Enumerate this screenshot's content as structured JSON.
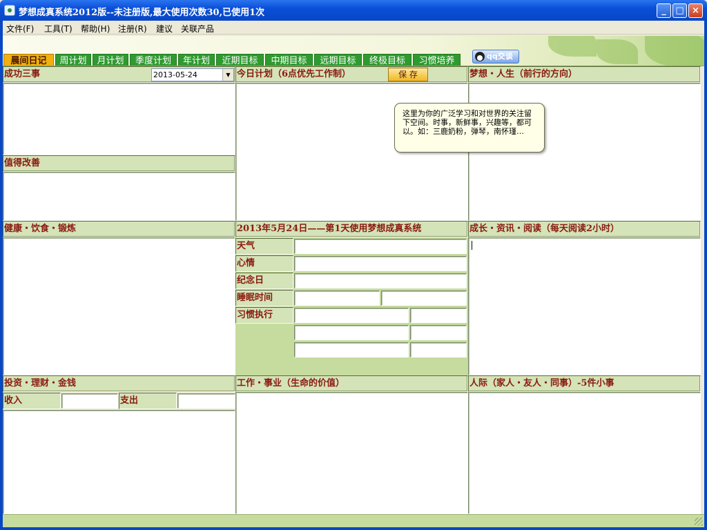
{
  "window": {
    "title": "梦想成真系统2012版--未注册版,最大使用次数30,已使用1次",
    "min": "_",
    "max": "□",
    "close": "×"
  },
  "menu": [
    "文件(F)",
    "工具(T)",
    "帮助(H)",
    "注册(R)",
    "建议",
    "关联产品"
  ],
  "tabs": [
    "晨间日记",
    "周计划",
    "月计划",
    "季度计划",
    "年计划",
    "近期目标",
    "中期目标",
    "远期目标",
    "终极目标",
    "习惯培养"
  ],
  "active_tab": "晨间日记",
  "qq_button": "qq交谈",
  "panels": {
    "success": "成功三事",
    "date": "2013-05-24",
    "improve": "值得改善",
    "plan": "今日计划（6点优先工作制）",
    "save": "保 存",
    "dream": "梦想・人生（前行的方向）",
    "tooltip": "这里为你的广泛学习和对世界的关注留下空间。时事，新鲜事，兴趣等，都可以。如：三鹿奶粉，弹琴，南怀瑾…",
    "health": "健康・饮食・锻炼",
    "day_header": "2013年5月24日——第1天使用梦想成真系统",
    "weather": "天气",
    "mood": "心情",
    "anniversary": "纪念日",
    "sleep": "睡眠时间",
    "habit": "习惯执行",
    "growth": "成长・资讯・阅读（每天阅读2小时）",
    "invest": "投资・理财・金钱",
    "income": "收入",
    "expense": "支出",
    "work": "工作・事业（生命的价值）",
    "people": "人际（家人・友人・同事）-5件小事"
  },
  "colors": {
    "title_bar": "#0a4fd8",
    "tab": "#2f9a2f",
    "active_tab": "#f0b010",
    "header_bg": "#d4e3b8",
    "header_text": "#8a1a10"
  }
}
